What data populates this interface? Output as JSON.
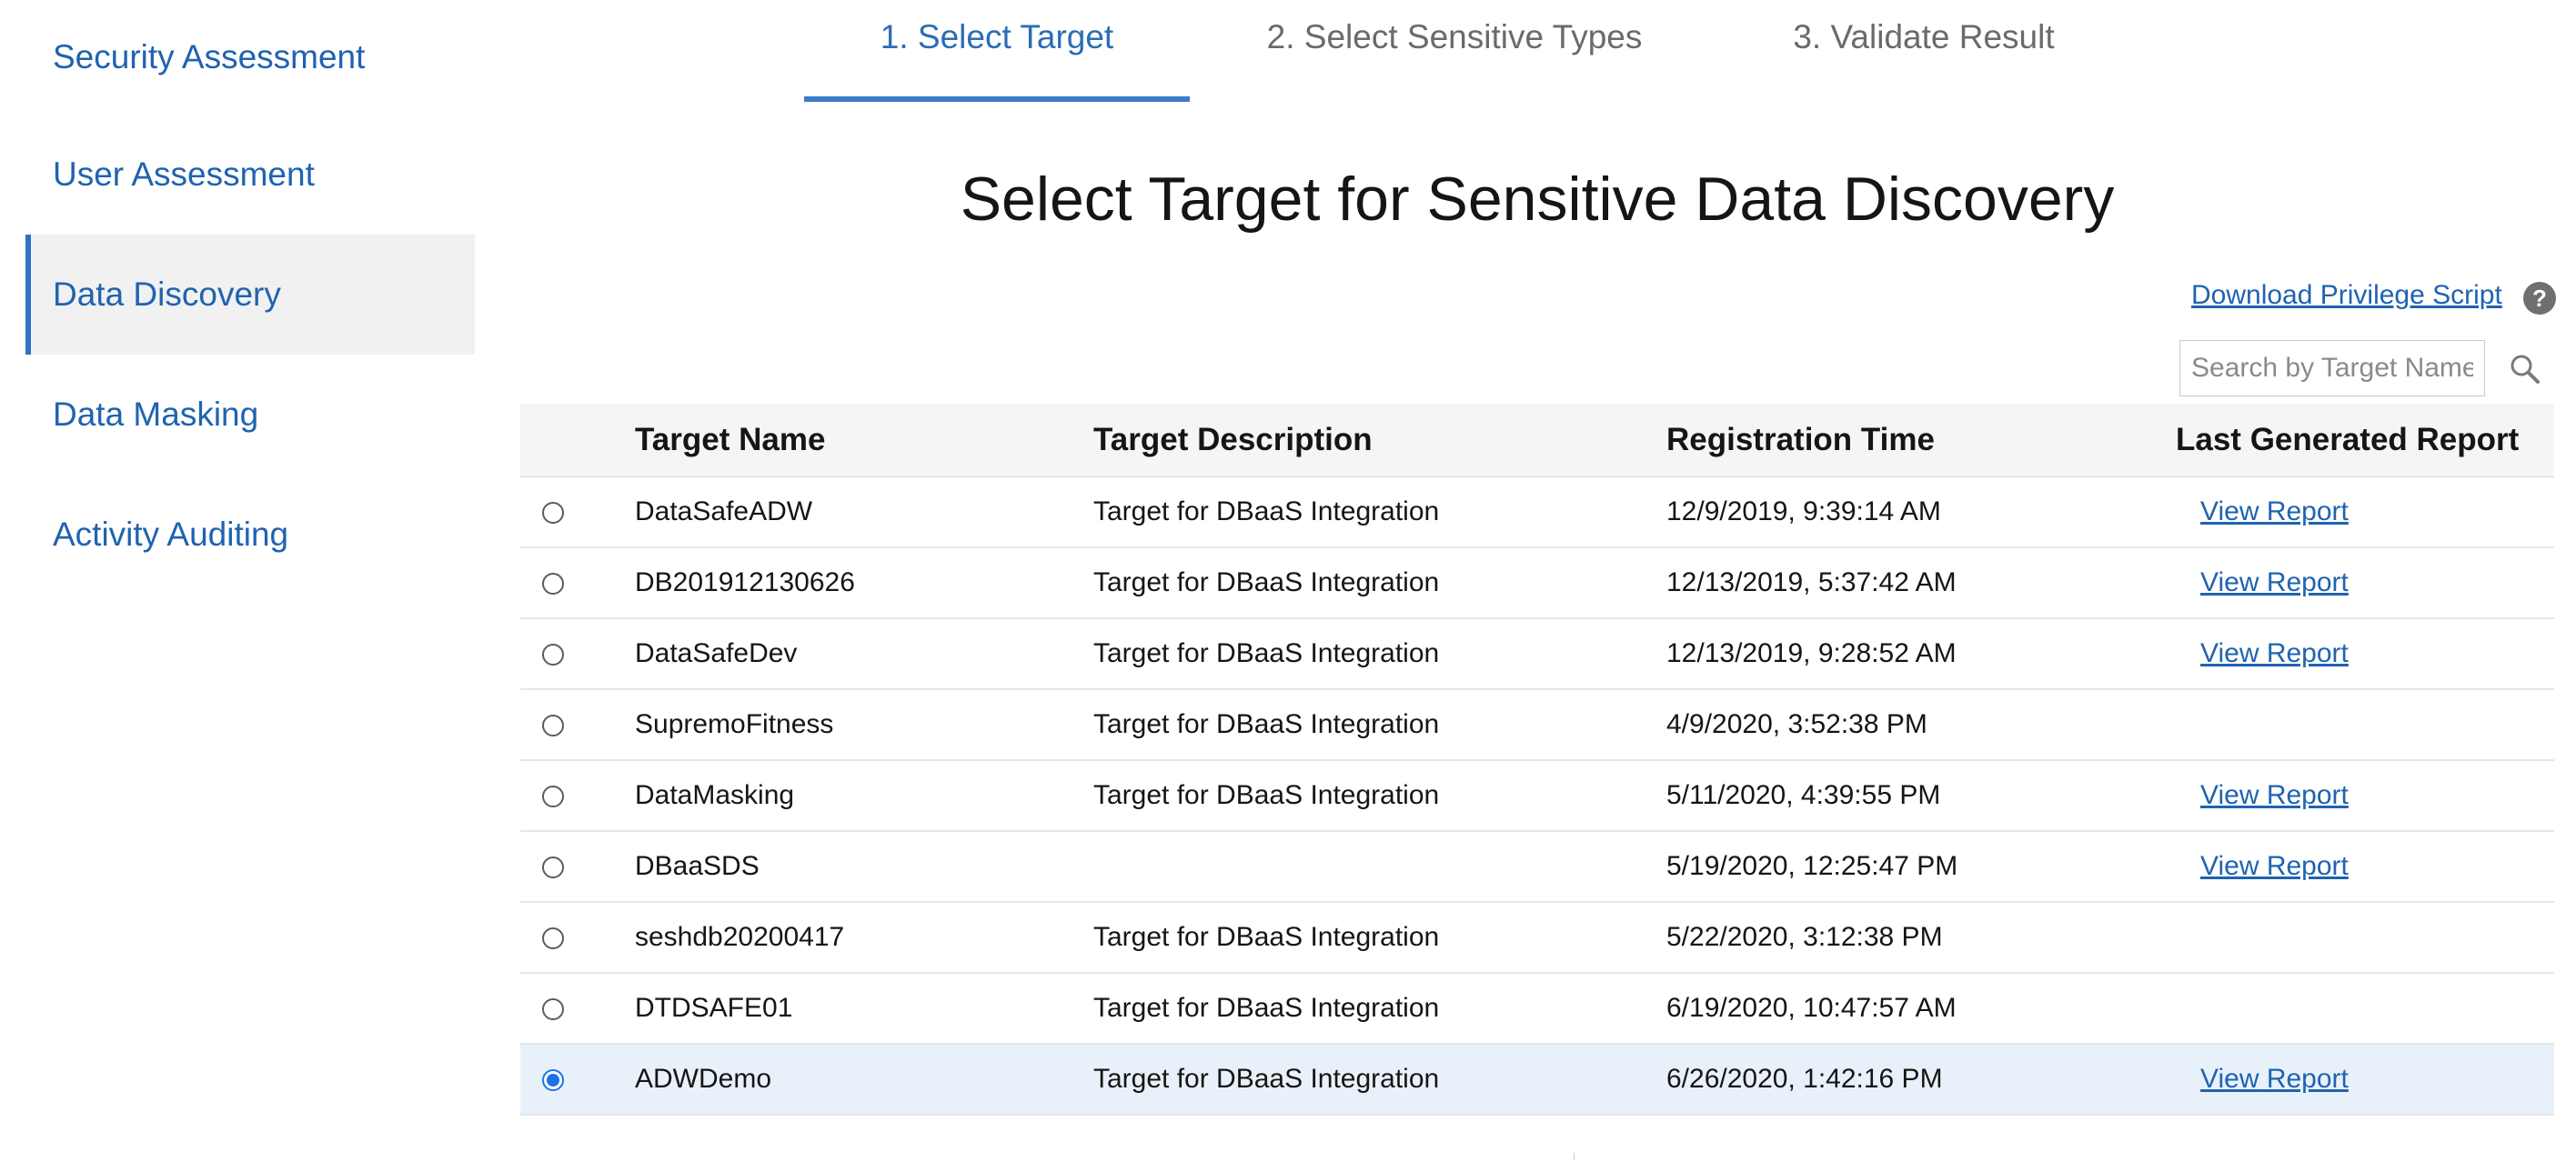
{
  "sidebar": {
    "items": [
      {
        "label": "Security Assessment"
      },
      {
        "label": "User Assessment"
      },
      {
        "label": "Data Discovery"
      },
      {
        "label": "Data Masking"
      },
      {
        "label": "Activity Auditing"
      }
    ],
    "active_index": 2
  },
  "steps": [
    {
      "label": "1. Select Target"
    },
    {
      "label": "2. Select Sensitive Types"
    },
    {
      "label": "3. Validate Result"
    }
  ],
  "active_step": 0,
  "page_title": "Select Target for Sensitive Data Discovery",
  "toolbar": {
    "download_label": "Download Privilege Script",
    "help_icon": "question-mark-icon",
    "search_placeholder": "Search by Target Name",
    "search_value": ""
  },
  "table": {
    "headers": {
      "name": "Target Name",
      "description": "Target Description",
      "registration_time": "Registration Time",
      "report": "Last Generated Report"
    },
    "rows": [
      {
        "name": "DataSafeADW",
        "description": "Target for DBaaS Integration",
        "time": "12/9/2019, 9:39:14 AM",
        "report": "View Report",
        "selected": false
      },
      {
        "name": "DB201912130626",
        "description": "Target for DBaaS Integration",
        "time": "12/13/2019, 5:37:42 AM",
        "report": "View Report",
        "selected": false
      },
      {
        "name": "DataSafeDev",
        "description": "Target for DBaaS Integration",
        "time": "12/13/2019, 9:28:52 AM",
        "report": "View Report",
        "selected": false
      },
      {
        "name": "SupremoFitness",
        "description": "Target for DBaaS Integration",
        "time": "4/9/2020, 3:52:38 PM",
        "report": "",
        "selected": false
      },
      {
        "name": "DataMasking",
        "description": "Target for DBaaS Integration",
        "time": "5/11/2020, 4:39:55 PM",
        "report": "View Report",
        "selected": false
      },
      {
        "name": "DBaaSDS",
        "description": "",
        "time": "5/19/2020, 12:25:47 PM",
        "report": "View Report",
        "selected": false
      },
      {
        "name": "seshdb20200417",
        "description": "Target for DBaaS Integration",
        "time": "5/22/2020, 3:12:38 PM",
        "report": "",
        "selected": false
      },
      {
        "name": "DTDSAFE01",
        "description": "Target for DBaaS Integration",
        "time": "6/19/2020, 10:47:57 AM",
        "report": "",
        "selected": false
      },
      {
        "name": "ADWDemo",
        "description": "Target for DBaaS Integration",
        "time": "6/26/2020, 1:42:16 PM",
        "report": "View Report",
        "selected": true
      }
    ]
  },
  "colors": {
    "link": "#1f63b0",
    "accent": "#3a7bc8",
    "selected_row": "#e8f1fa",
    "sidebar_active_bg": "#f1f1f1",
    "radio_checked": "#1a73e8"
  }
}
